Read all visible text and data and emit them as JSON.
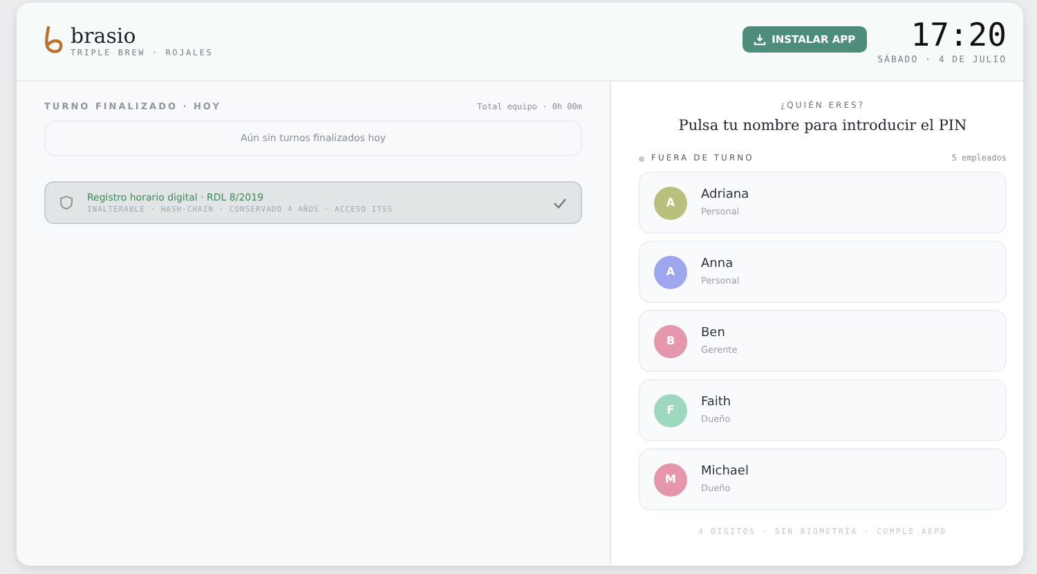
{
  "brand": {
    "name": "brasio",
    "subtitle": "TRIPLE BREW · ROJALES"
  },
  "install_button": {
    "label": "INSTALAR APP"
  },
  "clock": {
    "time": "17:20",
    "date": "SÁBADO · 4 DE JULIO"
  },
  "shifts": {
    "title": "TURNO FINALIZADO · HOY",
    "total": "Total equipo · 0h 00m",
    "empty": "Aún sin turnos finalizados hoy"
  },
  "compliance": {
    "title": "Registro horario digital · RDL 8/2019",
    "details": "INALTERABLE · HASH-CHAIN · CONSERVADO 4 AÑOS · ACCESO ITSS"
  },
  "login": {
    "eyebrow": "¿QUIÉN ERES?",
    "heading": "Pulsa tu nombre para introducir el PIN",
    "section": "FUERA DE TURNO",
    "count": "5 empleados",
    "employees": [
      {
        "initial": "A",
        "name": "Adriana",
        "role": "Personal",
        "color": "#b9c07e"
      },
      {
        "initial": "A",
        "name": "Anna",
        "role": "Personal",
        "color": "#9ea6ee"
      },
      {
        "initial": "B",
        "name": "Ben",
        "role": "Gerente",
        "color": "#e597ad"
      },
      {
        "initial": "F",
        "name": "Faith",
        "role": "Dueño",
        "color": "#9ed8bf"
      },
      {
        "initial": "M",
        "name": "Michael",
        "role": "Dueño",
        "color": "#e596aa"
      }
    ],
    "footer": "4 DÍGITOS · SIN BIOMETRÍA · CUMPLE AEPD"
  }
}
